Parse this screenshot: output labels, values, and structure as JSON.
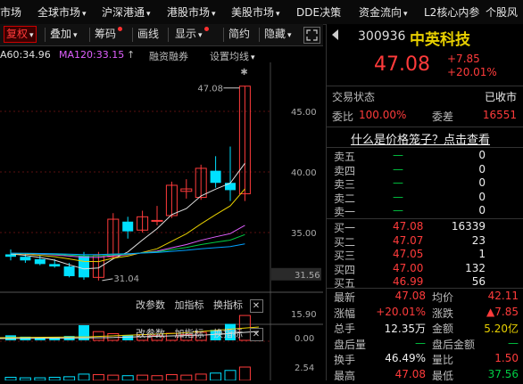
{
  "topnav": {
    "items": [
      {
        "label": "市场",
        "caret": false
      },
      {
        "label": "全球市场",
        "caret": true
      },
      {
        "label": "沪深港通",
        "caret": true
      },
      {
        "label": "港股市场",
        "caret": true
      },
      {
        "label": "美股市场",
        "caret": true
      },
      {
        "label": "DDE决策",
        "caret": false
      },
      {
        "label": "资金流向",
        "caret": true
      },
      {
        "label": "L2核心内参",
        "caret": false
      },
      {
        "label": "个股风",
        "caret": false
      }
    ]
  },
  "toolbar": {
    "fuquan": "复权",
    "overlay": "叠加",
    "chips": "筹码",
    "draw": "画线",
    "display": "显示",
    "simple": "简约",
    "hide": "隐藏",
    "caret": "▾",
    "expand_icon": "expand-icon"
  },
  "ma_legend": {
    "ma60": "A60:34.96",
    "ma120": "MA120:33.15",
    "up_arrow": "↑",
    "margin": "融资融券",
    "settings": "设置均线",
    "settings_caret": "▾"
  },
  "stock": {
    "code": "300936",
    "name": "中英科技",
    "price": "47.08",
    "change": "+7.85",
    "pct": "+20.01%"
  },
  "status": {
    "label": "交易状态",
    "value": "已收市",
    "ratio_label": "委比",
    "ratio_value": "100.00%",
    "diff_label": "委差",
    "diff_value": "16551"
  },
  "cage_link": "什么是价格笼子？点击查看",
  "order_book": {
    "asks": [
      {
        "label": "卖五",
        "price": "—",
        "vol": "0"
      },
      {
        "label": "卖四",
        "price": "—",
        "vol": "0"
      },
      {
        "label": "卖三",
        "price": "—",
        "vol": "0"
      },
      {
        "label": "卖二",
        "price": "—",
        "vol": "0"
      },
      {
        "label": "卖一",
        "price": "—",
        "vol": "0"
      }
    ],
    "bids": [
      {
        "label": "买一",
        "price": "47.08",
        "vol": "16339"
      },
      {
        "label": "买二",
        "price": "47.07",
        "vol": "23"
      },
      {
        "label": "买三",
        "price": "47.05",
        "vol": "1"
      },
      {
        "label": "买四",
        "price": "47.00",
        "vol": "132"
      },
      {
        "label": "买五",
        "price": "46.99",
        "vol": "56"
      }
    ]
  },
  "quote_stats": [
    {
      "l1": "最新",
      "v1": "47.08",
      "c1": "red",
      "l2": "均价",
      "v2": "42.11",
      "c2": "red"
    },
    {
      "l1": "涨幅",
      "v1": "+20.01%",
      "c1": "red",
      "l2": "涨跌",
      "v2": "▲7.85",
      "c2": "red"
    },
    {
      "l1": "总手",
      "v1": "12.35万",
      "c1": "white",
      "l2": "金额",
      "v2": "5.20亿",
      "c2": "yellow"
    },
    {
      "l1": "盘后量",
      "v1": "—",
      "c1": "green",
      "l2": "盘后金额",
      "v2": "—",
      "c2": "green"
    },
    {
      "l1": "换手",
      "v1": "46.49%",
      "c1": "white",
      "l2": "量比",
      "v2": "1.50",
      "c2": "red"
    },
    {
      "l1": "最高",
      "v1": "47.08",
      "c1": "red",
      "l2": "最低",
      "v2": "37.56",
      "c2": "green"
    }
  ],
  "price_axis": {
    "ticks": [
      "45.00",
      "40.00",
      "35.00"
    ],
    "current": "31.56"
  },
  "candle_labels": {
    "high": "47.08",
    "low": "31.04",
    "top_marker": "⬍",
    "star": "✱"
  },
  "sub1": {
    "params": "改参数",
    "add": "加指标",
    "swap": "换指标",
    "close": "✕",
    "ticks": [
      "15.90",
      "0.00"
    ]
  },
  "sub2": {
    "params": "改参数",
    "add": "加指标",
    "swap": "换指标",
    "close": "✕",
    "ticks": [
      "2.54"
    ]
  },
  "colors": {
    "up": "#ff3b3b",
    "down": "#00e0ff",
    "bg": "#000000",
    "yellow": "#e8d000",
    "green": "#00cc44"
  },
  "candles": [
    {
      "o": 33.2,
      "h": 33.6,
      "l": 32.7,
      "c": 33.0
    },
    {
      "o": 33.0,
      "h": 33.3,
      "l": 32.5,
      "c": 32.7
    },
    {
      "o": 32.8,
      "h": 33.1,
      "l": 32.3,
      "c": 32.4
    },
    {
      "o": 32.4,
      "h": 32.8,
      "l": 32.1,
      "c": 32.2
    },
    {
      "o": 32.2,
      "h": 32.5,
      "l": 31.3,
      "c": 31.4
    },
    {
      "o": 33.1,
      "h": 33.4,
      "l": 31.1,
      "c": 31.3
    },
    {
      "o": 31.3,
      "h": 33.4,
      "l": 31.04,
      "c": 33.1
    },
    {
      "o": 33.0,
      "h": 36.6,
      "l": 32.9,
      "c": 36.1
    },
    {
      "o": 35.9,
      "h": 36.3,
      "l": 34.5,
      "c": 35.1
    },
    {
      "o": 35.2,
      "h": 36.8,
      "l": 35.0,
      "c": 36.3
    },
    {
      "o": 36.0,
      "h": 37.2,
      "l": 35.6,
      "c": 36.0
    },
    {
      "o": 36.4,
      "h": 39.2,
      "l": 36.2,
      "c": 38.9
    },
    {
      "o": 38.4,
      "h": 39.4,
      "l": 37.8,
      "c": 38.6
    },
    {
      "o": 37.9,
      "h": 40.6,
      "l": 37.7,
      "c": 40.3
    },
    {
      "o": 40.1,
      "h": 41.3,
      "l": 38.7,
      "c": 39.1
    },
    {
      "o": 39.1,
      "h": 42.1,
      "l": 37.6,
      "c": 38.5
    },
    {
      "o": 38.2,
      "h": 47.08,
      "l": 37.6,
      "c": 47.08
    }
  ],
  "vol1": [
    3.0,
    2.2,
    1.6,
    1.8,
    2.6,
    9.0,
    5.2,
    4.0,
    3.2,
    3.4,
    2.8,
    4.2,
    3.5,
    4.8,
    6.2,
    9.8,
    14.8
  ],
  "vol2": [
    0.6,
    0.5,
    0.5,
    0.6,
    0.7,
    1.2,
    1.1,
    1.0,
    0.9,
    1.0,
    0.9,
    1.1,
    1.0,
    1.2,
    1.4,
    1.9,
    2.54
  ]
}
